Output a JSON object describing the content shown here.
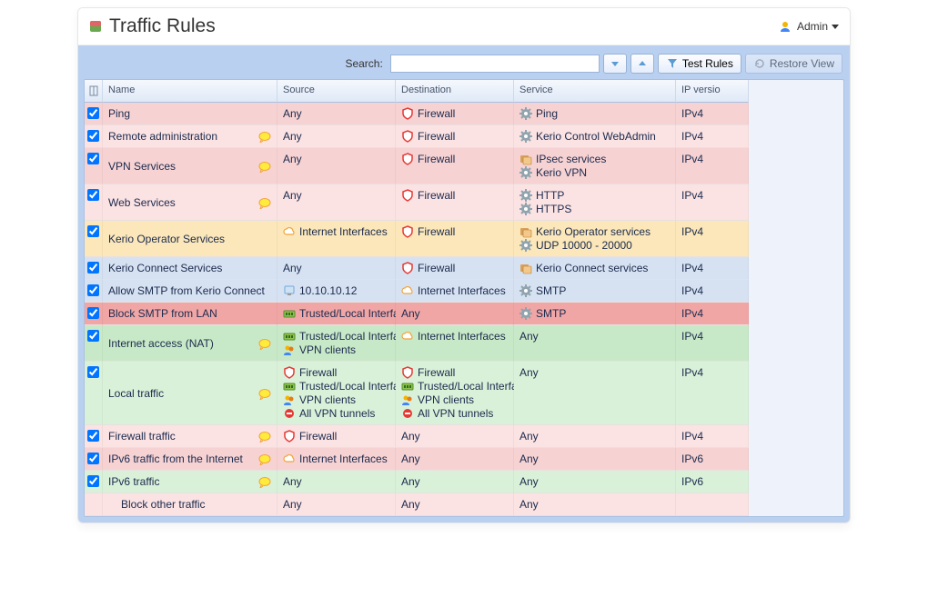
{
  "header": {
    "title": "Traffic Rules",
    "user": "Admin"
  },
  "toolbar": {
    "search_label": "Search:",
    "search_value": "",
    "test_rules": "Test Rules",
    "restore_view": "Restore View"
  },
  "columns": [
    "",
    "Name",
    "Source",
    "Destination",
    "Service",
    "IP versio"
  ],
  "rows": [
    {
      "color": "pink",
      "checked": true,
      "name": "Ping",
      "note": false,
      "source": [
        {
          "icon": "",
          "text": "Any"
        }
      ],
      "destination": [
        {
          "icon": "shield",
          "text": "Firewall"
        }
      ],
      "service": [
        {
          "icon": "gear",
          "text": "Ping"
        }
      ],
      "ipver": "IPv4"
    },
    {
      "color": "lpink",
      "checked": true,
      "name": "Remote administration",
      "note": true,
      "source": [
        {
          "icon": "",
          "text": "Any"
        }
      ],
      "destination": [
        {
          "icon": "shield",
          "text": "Firewall"
        }
      ],
      "service": [
        {
          "icon": "gear",
          "text": "Kerio Control WebAdmin"
        }
      ],
      "ipver": "IPv4"
    },
    {
      "color": "pink",
      "checked": true,
      "name": "VPN Services",
      "note": true,
      "source": [
        {
          "icon": "",
          "text": "Any"
        }
      ],
      "destination": [
        {
          "icon": "shield",
          "text": "Firewall"
        }
      ],
      "service": [
        {
          "icon": "group",
          "text": "IPsec services"
        },
        {
          "icon": "gear",
          "text": "Kerio VPN"
        }
      ],
      "ipver": "IPv4"
    },
    {
      "color": "lpink",
      "checked": true,
      "name": "Web Services",
      "note": true,
      "source": [
        {
          "icon": "",
          "text": "Any"
        }
      ],
      "destination": [
        {
          "icon": "shield",
          "text": "Firewall"
        }
      ],
      "service": [
        {
          "icon": "gear",
          "text": "HTTP"
        },
        {
          "icon": "gear",
          "text": "HTTPS"
        }
      ],
      "ipver": "IPv4"
    },
    {
      "color": "orange",
      "checked": true,
      "name": "Kerio Operator Services",
      "note": false,
      "source": [
        {
          "icon": "cloud",
          "text": "Internet Interfaces"
        }
      ],
      "destination": [
        {
          "icon": "shield",
          "text": "Firewall"
        }
      ],
      "service": [
        {
          "icon": "group",
          "text": "Kerio Operator services"
        },
        {
          "icon": "gear",
          "text": "UDP 10000 - 20000"
        }
      ],
      "ipver": "IPv4"
    },
    {
      "color": "blue",
      "checked": true,
      "name": "Kerio Connect Services",
      "note": false,
      "source": [
        {
          "icon": "",
          "text": "Any"
        }
      ],
      "destination": [
        {
          "icon": "shield",
          "text": "Firewall"
        }
      ],
      "service": [
        {
          "icon": "group",
          "text": "Kerio Connect services"
        }
      ],
      "ipver": "IPv4"
    },
    {
      "color": "blue",
      "checked": true,
      "name": "Allow SMTP from Kerio Connect",
      "note": false,
      "source": [
        {
          "icon": "host",
          "text": "10.10.10.12"
        }
      ],
      "destination": [
        {
          "icon": "cloud",
          "text": "Internet Interfaces"
        }
      ],
      "service": [
        {
          "icon": "gear",
          "text": "SMTP"
        }
      ],
      "ipver": "IPv4"
    },
    {
      "color": "red",
      "checked": true,
      "name": "Block SMTP from LAN",
      "note": false,
      "source": [
        {
          "icon": "nic",
          "text": "Trusted/Local Interfaces"
        }
      ],
      "destination": [
        {
          "icon": "",
          "text": "Any"
        }
      ],
      "service": [
        {
          "icon": "gear",
          "text": "SMTP"
        }
      ],
      "ipver": "IPv4"
    },
    {
      "color": "green",
      "checked": true,
      "name": "Internet access (NAT)",
      "note": true,
      "source": [
        {
          "icon": "nic",
          "text": "Trusted/Local Interfaces"
        },
        {
          "icon": "users",
          "text": "VPN clients"
        }
      ],
      "destination": [
        {
          "icon": "cloud",
          "text": "Internet Interfaces"
        }
      ],
      "service": [
        {
          "icon": "",
          "text": "Any"
        }
      ],
      "ipver": "IPv4"
    },
    {
      "color": "lgreen",
      "checked": true,
      "name": "Local traffic",
      "note": true,
      "source": [
        {
          "icon": "shield",
          "text": "Firewall"
        },
        {
          "icon": "nic",
          "text": "Trusted/Local Interfaces"
        },
        {
          "icon": "users",
          "text": "VPN clients"
        },
        {
          "icon": "tunnel",
          "text": "All VPN tunnels"
        }
      ],
      "destination": [
        {
          "icon": "shield",
          "text": "Firewall"
        },
        {
          "icon": "nic",
          "text": "Trusted/Local Interfaces"
        },
        {
          "icon": "users",
          "text": "VPN clients"
        },
        {
          "icon": "tunnel",
          "text": "All VPN tunnels"
        }
      ],
      "service": [
        {
          "icon": "",
          "text": "Any"
        }
      ],
      "ipver": "IPv4"
    },
    {
      "color": "lpink",
      "checked": true,
      "name": "Firewall traffic",
      "note": true,
      "source": [
        {
          "icon": "shield",
          "text": "Firewall"
        }
      ],
      "destination": [
        {
          "icon": "",
          "text": "Any"
        }
      ],
      "service": [
        {
          "icon": "",
          "text": "Any"
        }
      ],
      "ipver": "IPv4"
    },
    {
      "color": "pink",
      "checked": true,
      "name": "IPv6 traffic from the Internet",
      "note": true,
      "source": [
        {
          "icon": "cloud",
          "text": "Internet Interfaces"
        }
      ],
      "destination": [
        {
          "icon": "",
          "text": "Any"
        }
      ],
      "service": [
        {
          "icon": "",
          "text": "Any"
        }
      ],
      "ipver": "IPv6"
    },
    {
      "color": "lgreen",
      "checked": true,
      "name": "IPv6 traffic",
      "note": true,
      "source": [
        {
          "icon": "",
          "text": "Any"
        }
      ],
      "destination": [
        {
          "icon": "",
          "text": "Any"
        }
      ],
      "service": [
        {
          "icon": "",
          "text": "Any"
        }
      ],
      "ipver": "IPv6"
    },
    {
      "color": "lpink",
      "checked": false,
      "name": "Block other traffic",
      "indent": true,
      "note": false,
      "source": [
        {
          "icon": "",
          "text": "Any"
        }
      ],
      "destination": [
        {
          "icon": "",
          "text": "Any"
        }
      ],
      "service": [
        {
          "icon": "",
          "text": "Any"
        }
      ],
      "ipver": ""
    }
  ]
}
